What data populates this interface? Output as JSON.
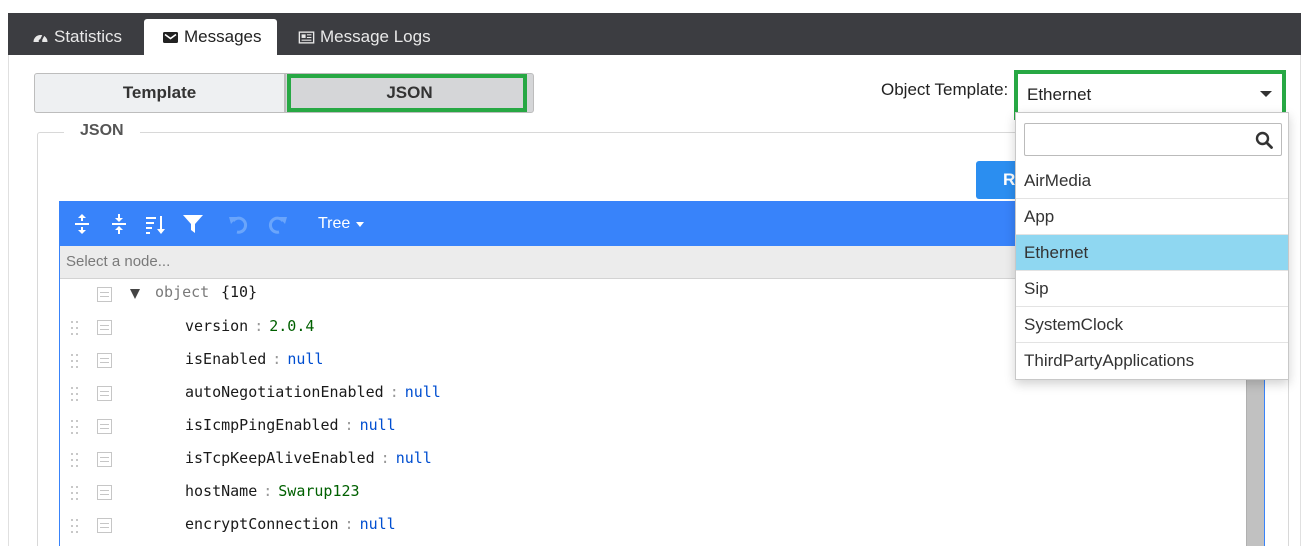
{
  "tabs": [
    {
      "label": "Statistics",
      "icon": "dashboard-icon",
      "active": false
    },
    {
      "label": "Messages",
      "icon": "envelope-icon",
      "active": true
    },
    {
      "label": "Message Logs",
      "icon": "newspaper-icon",
      "active": false
    }
  ],
  "toggle": {
    "template_label": "Template",
    "json_label": "JSON"
  },
  "object_template": {
    "label": "Object Template:",
    "selected": "Ethernet",
    "options": [
      "AirMedia",
      "App",
      "Ethernet",
      "Sip",
      "SystemClock",
      "ThirdPartyApplications"
    ]
  },
  "fieldset": {
    "legend": "JSON"
  },
  "action_button": {
    "visible_text": "R"
  },
  "editor": {
    "mode_label": "Tree",
    "nav_placeholder": "Select a node...",
    "root": {
      "type": "object",
      "count": "{10}"
    },
    "fields": [
      {
        "key": "version",
        "value": "2.0.4",
        "kind": "string"
      },
      {
        "key": "isEnabled",
        "value": "null",
        "kind": "null"
      },
      {
        "key": "autoNegotiationEnabled",
        "value": "null",
        "kind": "null"
      },
      {
        "key": "isIcmpPingEnabled",
        "value": "null",
        "kind": "null"
      },
      {
        "key": "isTcpKeepAliveEnabled",
        "value": "null",
        "kind": "null"
      },
      {
        "key": "hostName",
        "value": "Swarup123",
        "kind": "string"
      },
      {
        "key": "encryptConnection",
        "value": "null",
        "kind": "null"
      }
    ]
  },
  "colors": {
    "tabbar": "#3c3d41",
    "editor_blue": "#3883fa",
    "highlight_green": "#27a844",
    "selected_option": "#8fd7f1"
  }
}
